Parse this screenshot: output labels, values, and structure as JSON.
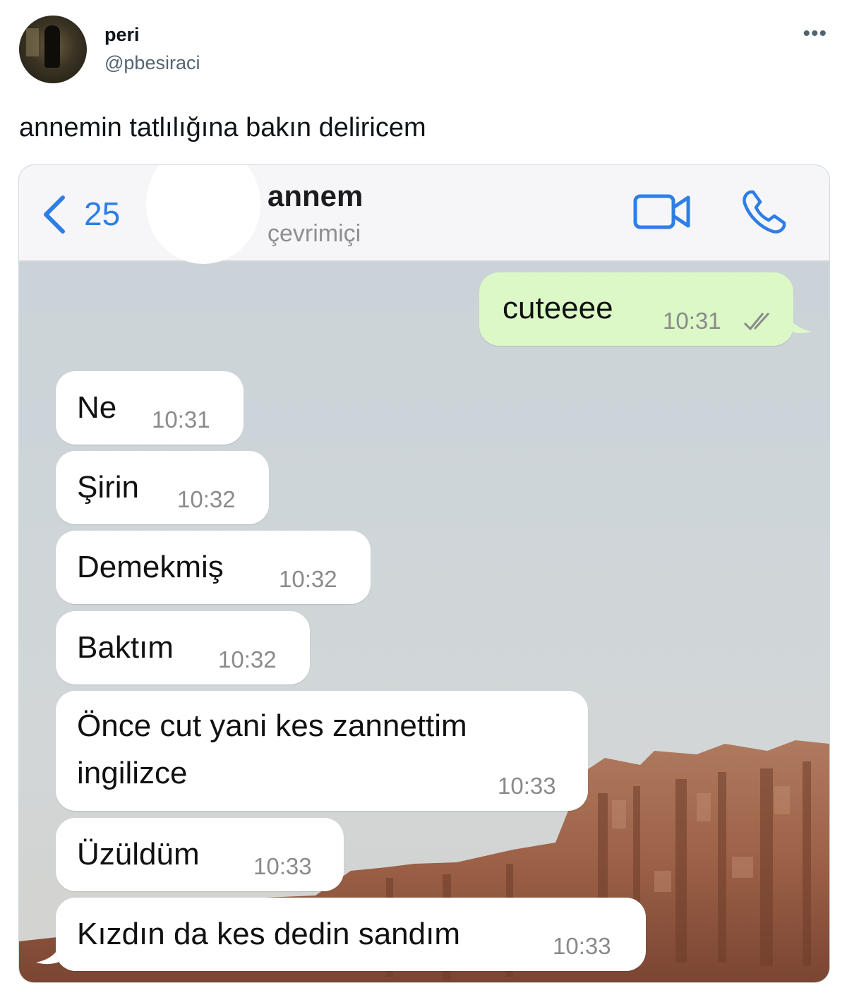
{
  "tweet": {
    "display_name": "peri",
    "handle": "@pbesiraci",
    "more_icon": "more-horizontal-icon",
    "text": "annemin tatlılığına bakın deliricem"
  },
  "chat": {
    "back_count": "25",
    "contact_name": "annem",
    "contact_status": "çevrimiçi",
    "accent_color": "#2f7ee6",
    "outgoing_bubble_color": "#dcf8c6",
    "incoming_bubble_color": "#ffffff",
    "icons": {
      "back": "chevron-left-icon",
      "video": "video-camera-icon",
      "call": "phone-icon",
      "read": "double-check-icon"
    },
    "messages": [
      {
        "direction": "out",
        "text": "cuteeee",
        "time": "10:31",
        "status": "read"
      },
      {
        "direction": "in",
        "text": "Ne",
        "time": "10:31"
      },
      {
        "direction": "in",
        "text": "Şirin",
        "time": "10:32"
      },
      {
        "direction": "in",
        "text": "Demekmiş",
        "time": "10:32"
      },
      {
        "direction": "in",
        "text": "Baktım",
        "time": "10:32"
      },
      {
        "direction": "in",
        "text": "Önce cut yani kes zannettim ingilizce",
        "time": "10:33"
      },
      {
        "direction": "in",
        "text": "Üzüldüm",
        "time": "10:33"
      },
      {
        "direction": "in",
        "text": "Kızdın da kes dedin sandım",
        "time": "10:33"
      }
    ]
  }
}
